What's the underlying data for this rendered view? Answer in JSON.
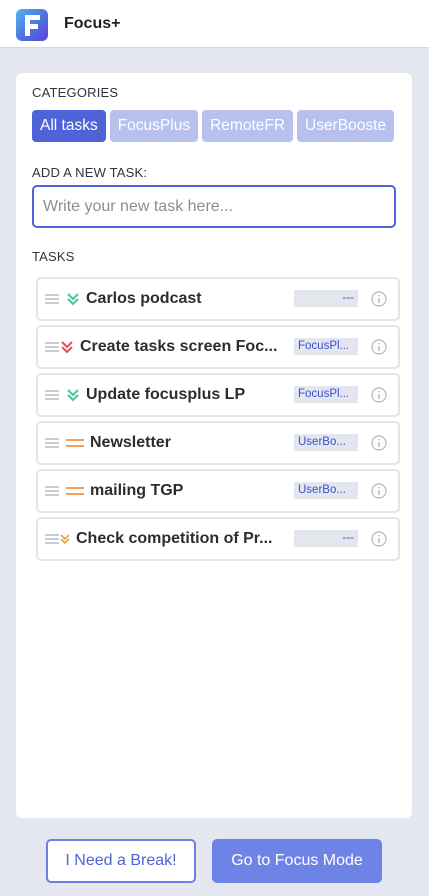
{
  "app": {
    "title": "Focus+",
    "logo_letter": "F"
  },
  "categories": {
    "label": "CATEGORIES",
    "items": [
      "All tasks",
      "FocusPlus",
      "RemoteFR",
      "UserBooste"
    ],
    "active": "All tasks"
  },
  "new_task": {
    "label": "ADD A NEW TASK:",
    "placeholder": "Write your new task here...",
    "value": ""
  },
  "tasks": {
    "label": "TASKS",
    "items": [
      {
        "name": "Carlos podcast",
        "priority": "low",
        "tag": "---"
      },
      {
        "name": "Create tasks screen Foc...",
        "priority": "high",
        "tag": "FocusPl..."
      },
      {
        "name": "Update focusplus LP",
        "priority": "low",
        "tag": "FocusPl..."
      },
      {
        "name": "Newsletter",
        "priority": "medium",
        "tag": "UserBo..."
      },
      {
        "name": "mailing TGP",
        "priority": "medium",
        "tag": "UserBo..."
      },
      {
        "name": "Check competition of Pr...",
        "priority": "lowest",
        "tag": "---"
      }
    ]
  },
  "buttons": {
    "break_label": "I Need a Break!",
    "focus_label": "Go to Focus Mode"
  },
  "colors": {
    "accent": "#4e63d8",
    "accent_light": "#b8c1ee",
    "priority_low": "#3ec7a5",
    "priority_high": "#e0525a",
    "priority_medium": "#f0a05a",
    "priority_lowest": "#e9a23b"
  },
  "icons": {
    "logo": "focus-plus-logo",
    "drag": "drag-handle-icon",
    "info": "info-icon",
    "low": "double-chevron-down-icon",
    "high": "double-chevron-down-icon",
    "medium": "equals-icon",
    "lowest": "double-chevron-down-icon"
  }
}
